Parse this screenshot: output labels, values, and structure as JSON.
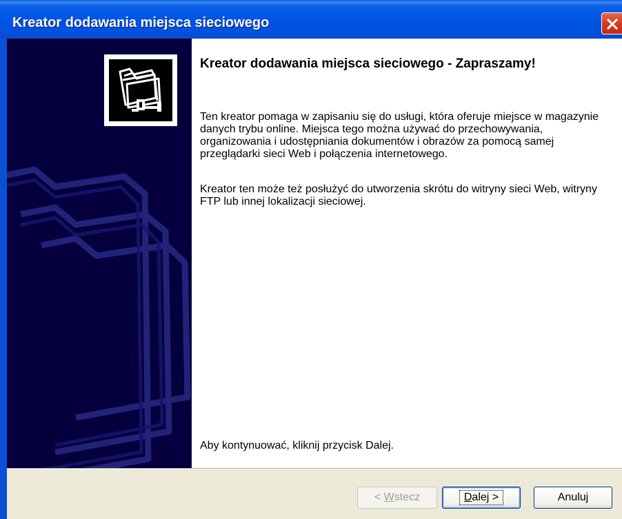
{
  "window": {
    "title": "Kreator dodawania miejsca sieciowego"
  },
  "page": {
    "heading": "Kreator dodawania miejsca sieciowego - Zapraszamy!",
    "paragraph1": "Ten kreator pomaga w zapisaniu się do usługi, która oferuje miejsce w magazynie danych trybu online. Miejsca tego można używać do przechowywania, organizowania i udostępniania dokumentów i obrazów za pomocą samej przeglądarki sieci Web i połączenia internetowego.",
    "paragraph2": "Kreator ten może też posłużyć do utworzenia skrótu do witryny sieci Web, witryny FTP  lub innej lokalizacji sieciowej.",
    "footer": "Aby kontynuować, kliknij przycisk Dalej."
  },
  "buttons": {
    "back": {
      "prefix": "< ",
      "mnemonic": "W",
      "rest": "stecz",
      "enabled": false
    },
    "next": {
      "mnemonic": "D",
      "rest": "alej >"
    },
    "cancel": {
      "label": "Anuluj"
    }
  },
  "icons": {
    "close": "close-icon",
    "wizard": "network-folder-icon",
    "watermark": "folders-watermark-icon"
  },
  "colors": {
    "titlebar": "#0055e5",
    "sidebar": "#05003d",
    "close": "#d2381c",
    "dialog_bg": "#ece9d8"
  }
}
